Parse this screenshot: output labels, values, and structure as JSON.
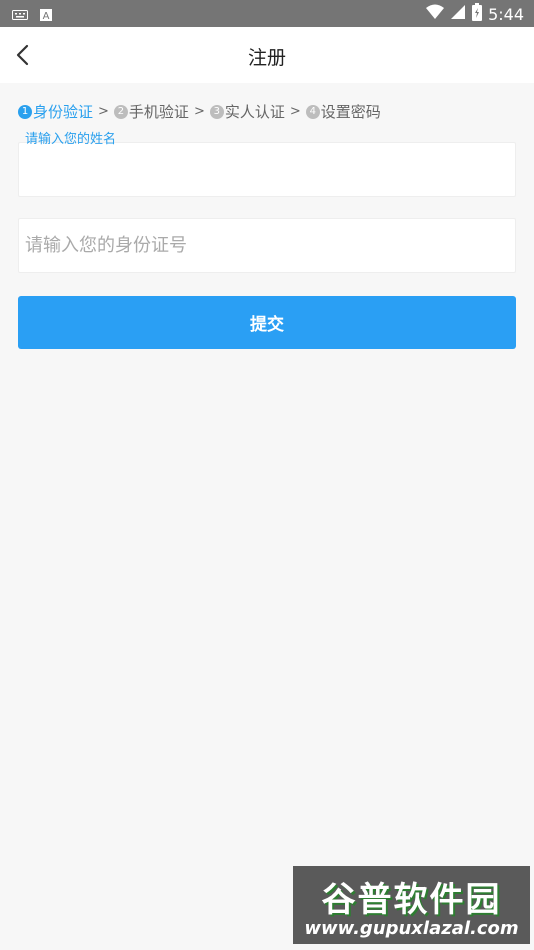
{
  "status_bar": {
    "time": "5:44",
    "icons": [
      "keyboard-icon",
      "a-icon",
      "wifi-icon",
      "signal-icon",
      "battery-icon"
    ]
  },
  "header": {
    "title": "注册",
    "back_icon": "chevron-left-icon"
  },
  "steps": [
    {
      "num": "1",
      "label": "身份验证",
      "active": true
    },
    {
      "num": "2",
      "label": "手机验证",
      "active": false
    },
    {
      "num": "3",
      "label": "实人认证",
      "active": false
    },
    {
      "num": "4",
      "label": "设置密码",
      "active": false
    }
  ],
  "step_separator": ">",
  "form": {
    "name_label": "请输入您的姓名",
    "name_value": "",
    "id_placeholder": "请输入您的身份证号",
    "id_value": "",
    "submit_label": "提交"
  },
  "colors": {
    "accent": "#2a9ff4",
    "status_bar": "#757575",
    "background": "#f7f7f7"
  },
  "watermark": {
    "text_cn": "谷普软件园",
    "url": "www.gupuxlazal.com"
  }
}
